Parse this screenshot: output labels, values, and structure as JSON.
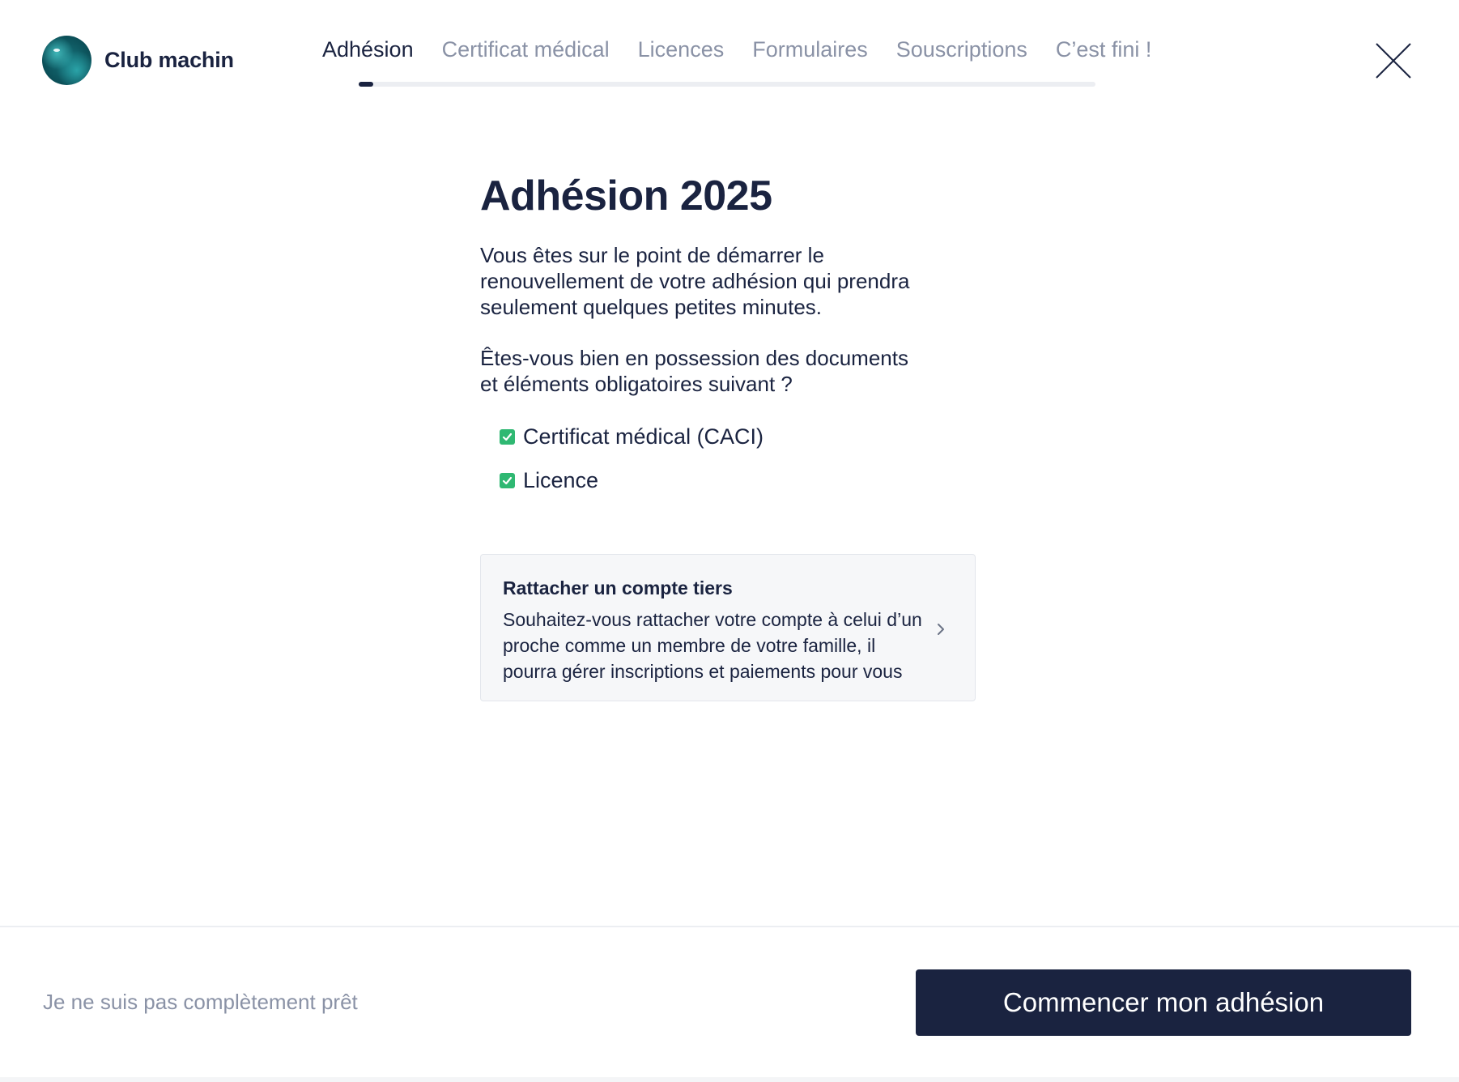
{
  "brand": {
    "name": "Club machin"
  },
  "steps": [
    {
      "label": "Adhésion",
      "active": true
    },
    {
      "label": "Certificat médical",
      "active": false
    },
    {
      "label": "Licences",
      "active": false
    },
    {
      "label": "Formulaires",
      "active": false
    },
    {
      "label": "Souscriptions",
      "active": false
    },
    {
      "label": "C’est fini !",
      "active": false
    }
  ],
  "progress": {
    "value": 0.02
  },
  "main": {
    "title": "Adhésion 2025",
    "intro": "Vous êtes sur le point de démarrer le renouvellement de votre adhésion qui prendra seulement quelques petites minutes.",
    "question": "Êtes-vous bien en possession des documents et éléments obligatoires suivant ?",
    "checklist": [
      {
        "label": "Certificat médical (CACI)",
        "checked": true
      },
      {
        "label": "Licence",
        "checked": true
      }
    ]
  },
  "card": {
    "title": "Rattacher un compte tiers",
    "description": "Souhaitez-vous rattacher votre compte à celui d’un proche comme un membre de votre famille, il pourra gérer inscriptions et paiements pour vous"
  },
  "footer": {
    "secondary_label": "Je ne suis pas complètement prêt",
    "primary_label": "Commencer mon adhésion"
  },
  "colors": {
    "primary": "#1a2340",
    "muted": "#8a92a6",
    "check_green": "#2fb872"
  },
  "icons": [
    "close-icon",
    "check-icon",
    "chevron-right-icon"
  ]
}
